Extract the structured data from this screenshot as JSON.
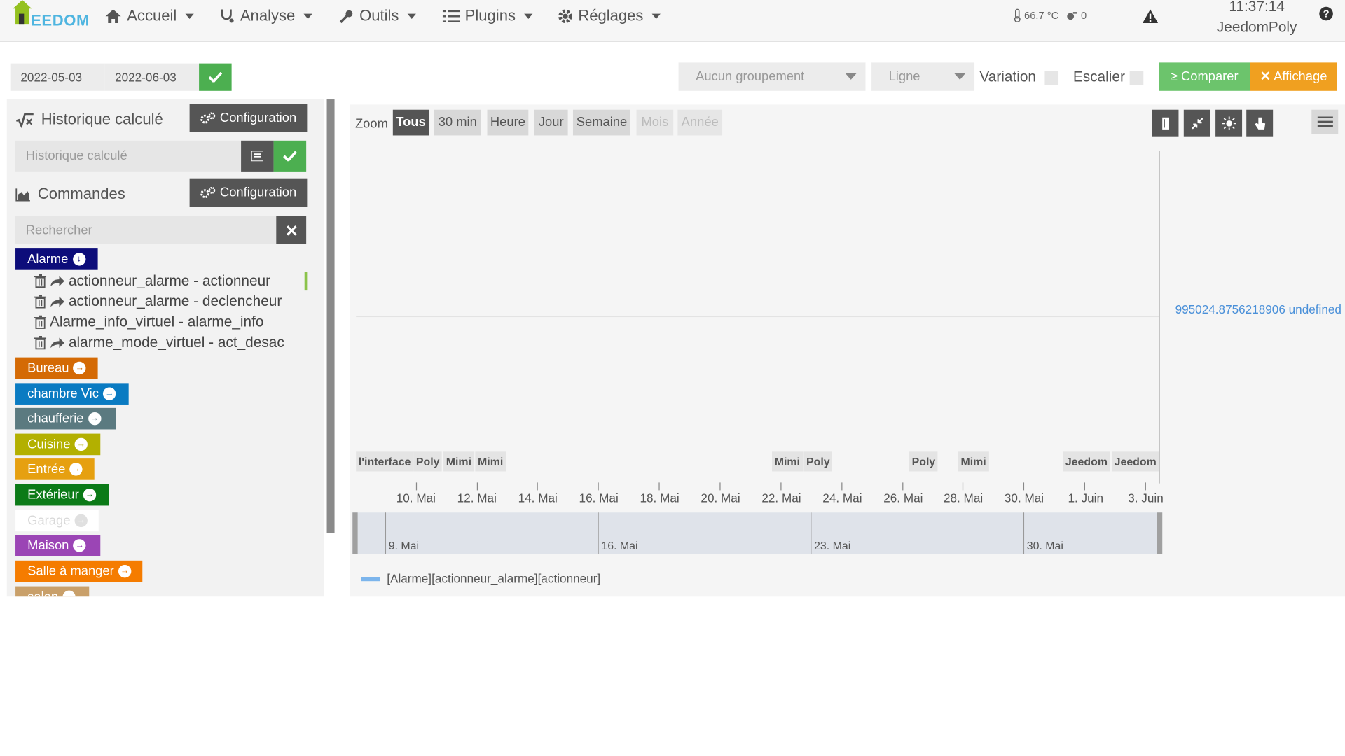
{
  "navbar": {
    "logo_text": "EEDOM",
    "menu": [
      {
        "label": "Accueil"
      },
      {
        "label": "Analyse"
      },
      {
        "label": "Outils"
      },
      {
        "label": "Plugins"
      },
      {
        "label": "Réglages"
      }
    ],
    "temperature": "66.7 °C",
    "alerts_count": "0",
    "time": "11:37:14",
    "hostname": "JeedomPoly"
  },
  "toolbar": {
    "date_start": "2022-05-03",
    "date_end": "2022-06-03",
    "grouping_select": "Aucun groupement",
    "type_select": "Ligne",
    "variation_label": "Variation",
    "escalier_label": "Escalier",
    "compare_label": "Comparer",
    "display_label": "Affichage",
    "colors": {
      "green": "#4caf50",
      "compare": "#5cb85c",
      "display": "#f0a020"
    }
  },
  "left": {
    "calc_title": "Historique calculé",
    "config_label": "Configuration",
    "calc_placeholder": "Historique calculé",
    "commands_title": "Commandes",
    "search_placeholder": "Rechercher",
    "groups": [
      {
        "label": "Alarme",
        "color": "#0d0d7a"
      },
      {
        "label": "Bureau",
        "color": "#d46a05"
      },
      {
        "label": "chambre Vic",
        "color": "#0a7bc2"
      },
      {
        "label": "chaufferie",
        "color": "#5b7a80"
      },
      {
        "label": "Cuisine",
        "color": "#b3b000"
      },
      {
        "label": "Entrée",
        "color": "#e6a010"
      },
      {
        "label": "Extérieur",
        "color": "#0b7a17"
      },
      {
        "label": "Garage",
        "color": "#ffffff"
      },
      {
        "label": "Maison",
        "color": "#9b45b5"
      },
      {
        "label": "Salle à manger",
        "color": "#f57c00"
      },
      {
        "label": "salon",
        "color": "#c9a06a"
      }
    ],
    "commands": [
      {
        "label": "actionneur_alarme - actionneur"
      },
      {
        "label": "actionneur_alarme - declencheur"
      },
      {
        "label": "Alarme_info_virtuel - alarme_info"
      },
      {
        "label": "alarme_mode_virtuel - act_desac"
      }
    ]
  },
  "chart": {
    "zoom_label": "Zoom",
    "zoom_buttons": [
      "Tous",
      "30 min",
      "Heure",
      "Jour",
      "Semaine",
      "Mois",
      "Année"
    ],
    "value_label": "995024.8756218906 undefined",
    "flags": [
      "l'interface",
      "Poly",
      "Mimi",
      "Mimi",
      "Mimi",
      "Poly",
      "Poly",
      "Mimi",
      "Jeedom",
      "Jeedom"
    ],
    "legend_series": "[Alarme][actionneur_alarme][actionneur]",
    "series_color": "#7cb5ec"
  },
  "chart_data": {
    "type": "line",
    "title": "",
    "x_tick_labels": [
      "10. Mai",
      "12. Mai",
      "14. Mai",
      "16. Mai",
      "18. Mai",
      "20. Mai",
      "22. Mai",
      "24. Mai",
      "26. Mai",
      "28. Mai",
      "30. Mai",
      "1. Juin",
      "3. Juin"
    ],
    "navigator_labels": [
      "9. Mai",
      "16. Mai",
      "23. Mai",
      "30. Mai"
    ],
    "series": [
      {
        "name": "[Alarme][actionneur_alarme][actionneur]",
        "values": []
      }
    ],
    "annotations": [
      "995024.8756218906 undefined"
    ],
    "grid": true
  }
}
